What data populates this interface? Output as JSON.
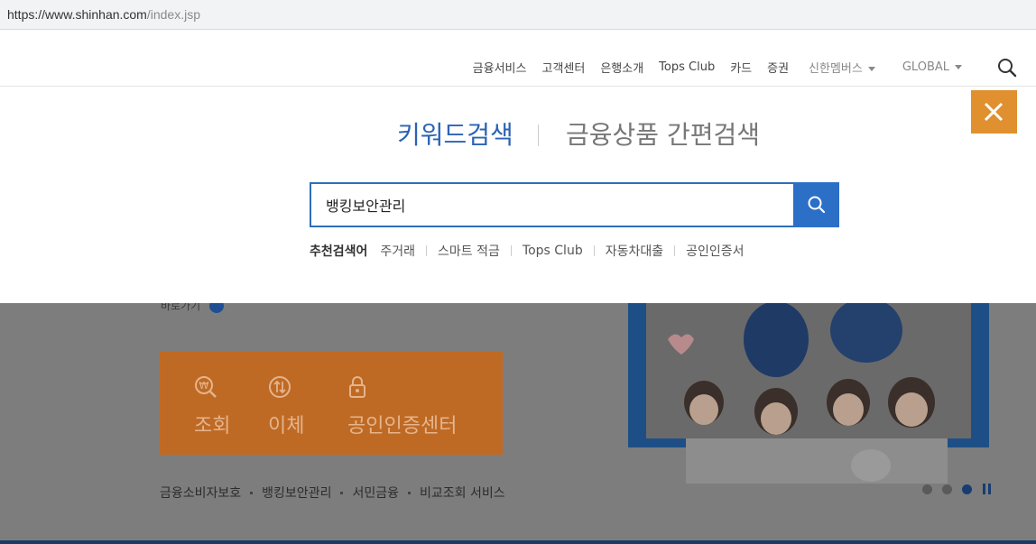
{
  "browser": {
    "url_host": "https://www.shinhan.com",
    "url_path": "/index.jsp"
  },
  "nav": {
    "items": [
      {
        "label": "금융서비스"
      },
      {
        "label": "고객센터"
      },
      {
        "label": "은행소개"
      },
      {
        "label": "Tops Club"
      },
      {
        "label": "카드"
      },
      {
        "label": "증권"
      }
    ],
    "dropdowns": [
      {
        "label": "신한멤버스"
      },
      {
        "label": "GLOBAL"
      }
    ]
  },
  "search_overlay": {
    "tabs": [
      {
        "label": "키워드검색",
        "active": true
      },
      {
        "label": "금융상품 간편검색",
        "active": false
      }
    ],
    "query": "뱅킹보안관리",
    "recommend_label": "추천검색어",
    "keywords": [
      "주거래",
      "스마트 적금",
      "Tops Club",
      "자동차대출",
      "공인인증서"
    ]
  },
  "background": {
    "more_label": "바로가기",
    "quick_menu": [
      {
        "label": "조회",
        "icon": "won-search-icon"
      },
      {
        "label": "이체",
        "icon": "transfer-icon"
      },
      {
        "label": "공인인증센터",
        "icon": "lock-icon"
      }
    ],
    "links": [
      "금융소비자보호",
      "뱅킹보안관리",
      "서민금융",
      "비교조회 서비스"
    ],
    "slider": {
      "count": 3,
      "active_index": 2
    }
  },
  "colors": {
    "accent_blue": "#2c63b3",
    "close_orange": "#e0902e",
    "quick_orange": "#bf6a24"
  }
}
